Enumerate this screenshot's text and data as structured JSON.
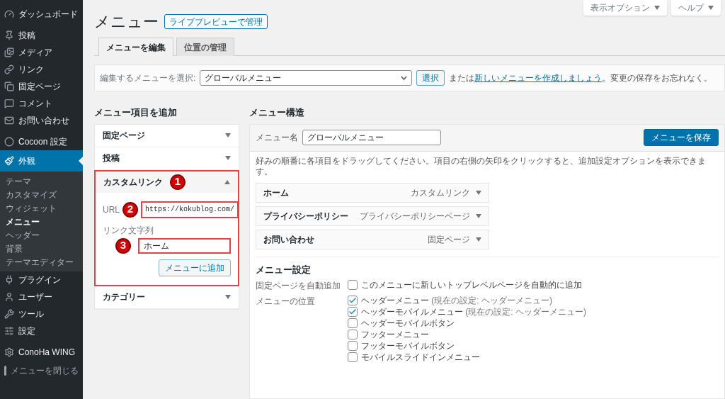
{
  "sidebar": {
    "items": [
      {
        "label": "ダッシュボード",
        "selected": false
      },
      {
        "label": "投稿",
        "selected": false
      },
      {
        "label": "メディア",
        "selected": false
      },
      {
        "label": "リンク",
        "selected": false
      },
      {
        "label": "固定ページ",
        "selected": false
      },
      {
        "label": "コメント",
        "selected": false
      },
      {
        "label": "お問い合わせ",
        "selected": false
      },
      {
        "label": "Cocoon 設定",
        "selected": false
      },
      {
        "label": "外観",
        "selected": true,
        "children": [
          {
            "label": "テーマ",
            "selected": false
          },
          {
            "label": "カスタマイズ",
            "selected": false
          },
          {
            "label": "ウィジェット",
            "selected": false
          },
          {
            "label": "メニュー",
            "selected": true
          },
          {
            "label": "ヘッダー",
            "selected": false
          },
          {
            "label": "背景",
            "selected": false
          },
          {
            "label": "テーマエディター",
            "selected": false
          }
        ]
      },
      {
        "label": "プラグイン",
        "selected": false
      },
      {
        "label": "ユーザー",
        "selected": false
      },
      {
        "label": "ツール",
        "selected": false
      },
      {
        "label": "設定",
        "selected": false
      },
      {
        "label": "ConoHa WING",
        "selected": false
      }
    ],
    "collapse": "メニューを閉じる"
  },
  "top_buttons": [
    "表示オプション",
    "ヘルプ"
  ],
  "page_title": "メニュー",
  "live_preview_button": "ライブプレビューで管理",
  "tabs": [
    {
      "label": "メニューを編集",
      "selected": true
    },
    {
      "label": "位置の管理",
      "selected": false
    }
  ],
  "select_menu": {
    "label": "編集するメニューを選択:",
    "value": "グローバルメニュー",
    "button": "選択",
    "note_before": "または",
    "link": "新しいメニューを作成しましょう",
    "note_after": "。変更の保存をお忘れなく。"
  },
  "add_items": {
    "heading": "メニュー項目を追加",
    "panels": [
      {
        "title": "固定ページ",
        "expanded": false,
        "highlighted": false
      },
      {
        "title": "投稿",
        "expanded": false,
        "highlighted": false
      },
      {
        "title": "カスタムリンク",
        "expanded": true,
        "highlighted": true,
        "callout": "1",
        "form": {
          "url_label": "URL",
          "url_value": "https://kokublog.com/",
          "url_callout": "2",
          "text_label": "リンク文字列",
          "text_value": "ホーム",
          "text_callout": "3",
          "button": "メニューに追加"
        }
      },
      {
        "title": "カテゴリー",
        "expanded": false,
        "highlighted": false
      }
    ]
  },
  "structure": {
    "heading": "メニュー構造",
    "name_label": "メニュー名",
    "name_value": "グローバルメニュー",
    "save_button": "メニューを保存",
    "instructions": "好みの順番に各項目をドラッグしてください。項目の右側の矢印をクリックすると、追加設定オプションを表示できます。",
    "items": [
      {
        "title": "ホーム",
        "type": "カスタムリンク"
      },
      {
        "title": "プライバシーポリシー",
        "type": "プライバシーポリシーページ"
      },
      {
        "title": "お問い合わせ",
        "type": "固定ページ"
      }
    ]
  },
  "settings": {
    "heading": "メニュー設定",
    "rows": [
      {
        "label": "固定ページを自動追加",
        "options": [
          {
            "label": "このメニューに新しいトップレベルページを自動的に追加",
            "checked": false
          }
        ]
      },
      {
        "label": "メニューの位置",
        "options": [
          {
            "label": "ヘッダーメニュー",
            "note": "(現在の設定: ヘッダーメニュー)",
            "checked": true
          },
          {
            "label": "ヘッダーモバイルメニュー",
            "note": "(現在の設定: ヘッダーメニュー)",
            "checked": true
          },
          {
            "label": "ヘッダーモバイルボタン",
            "checked": false
          },
          {
            "label": "フッターメニュー",
            "checked": false
          },
          {
            "label": "フッターモバイルボタン",
            "checked": false
          },
          {
            "label": "モバイルスライドインメニュー",
            "checked": false
          }
        ]
      }
    ]
  }
}
